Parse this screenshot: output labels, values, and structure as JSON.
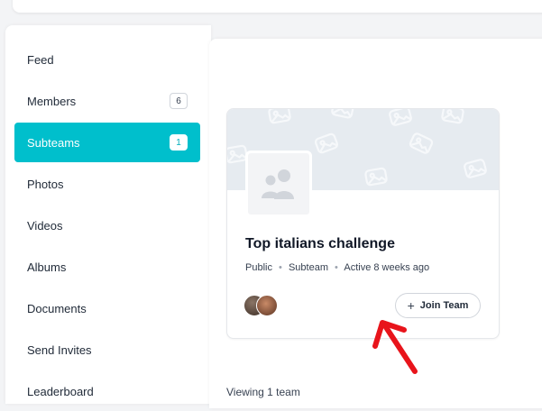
{
  "sidebar": {
    "items": [
      {
        "label": "Feed",
        "count": ""
      },
      {
        "label": "Members",
        "count": "6"
      },
      {
        "label": "Subteams",
        "count": "1",
        "active": true
      },
      {
        "label": "Photos",
        "count": ""
      },
      {
        "label": "Videos",
        "count": ""
      },
      {
        "label": "Albums",
        "count": ""
      },
      {
        "label": "Documents",
        "count": ""
      },
      {
        "label": "Send Invites",
        "count": ""
      },
      {
        "label": "Leaderboard",
        "count": ""
      }
    ]
  },
  "team_card": {
    "title": "Top italians challenge",
    "visibility": "Public",
    "type": "Subteam",
    "activity": "Active 8 weeks ago",
    "join_label": "Join Team",
    "join_icon": "plus-icon",
    "avatar_icon": "group-icon"
  },
  "footer": {
    "viewing_text": "Viewing 1 team"
  },
  "colors": {
    "accent": "#00bfcc",
    "arrow": "#e8141b",
    "cover": "#e6ebf0"
  }
}
